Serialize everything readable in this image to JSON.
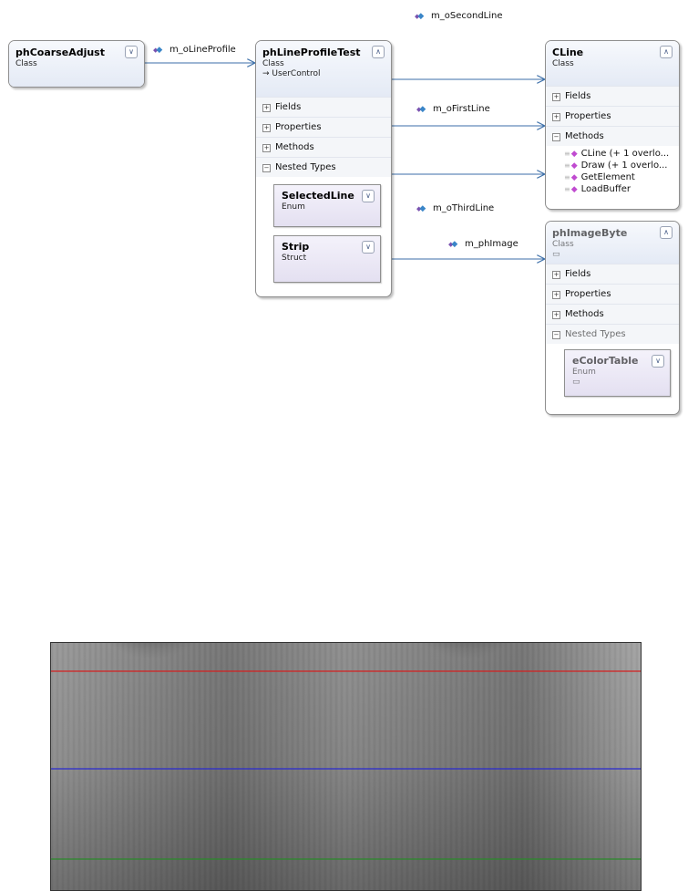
{
  "classes": {
    "coarse": {
      "name": "phCoarseAdjust",
      "kind": "Class"
    },
    "profile": {
      "name": "phLineProfileTest",
      "kind": "Class",
      "base": "UserControl",
      "sections": {
        "fields": "Fields",
        "properties": "Properties",
        "methods": "Methods",
        "nested": "Nested Types"
      },
      "nested_types": [
        {
          "name": "SelectedLine",
          "kind": "Enum"
        },
        {
          "name": "Strip",
          "kind": "Struct"
        }
      ]
    },
    "cline": {
      "name": "CLine",
      "kind": "Class",
      "sections": {
        "fields": "Fields",
        "properties": "Properties",
        "methods": "Methods"
      },
      "methods": [
        "CLine (+ 1 overlo...",
        "Draw (+ 1 overlo...",
        "GetElement",
        "LoadBuffer"
      ]
    },
    "image": {
      "name": "phImageByte",
      "kind": "Class",
      "sections": {
        "fields": "Fields",
        "properties": "Properties",
        "methods": "Methods",
        "nested": "Nested Types"
      },
      "nested_types": [
        {
          "name": "eColorTable",
          "kind": "Enum"
        }
      ]
    }
  },
  "associations": {
    "line_profile": "m_oLineProfile",
    "second_line": "m_oSecondLine",
    "first_line": "m_oFirstLine",
    "third_line": "m_oThirdLine",
    "image": "m_phImage"
  },
  "colors": {
    "connector": "#3b6ea8",
    "line_red": "#d42020",
    "line_blue": "#2a2ad0",
    "line_green": "#2a8a2a"
  }
}
